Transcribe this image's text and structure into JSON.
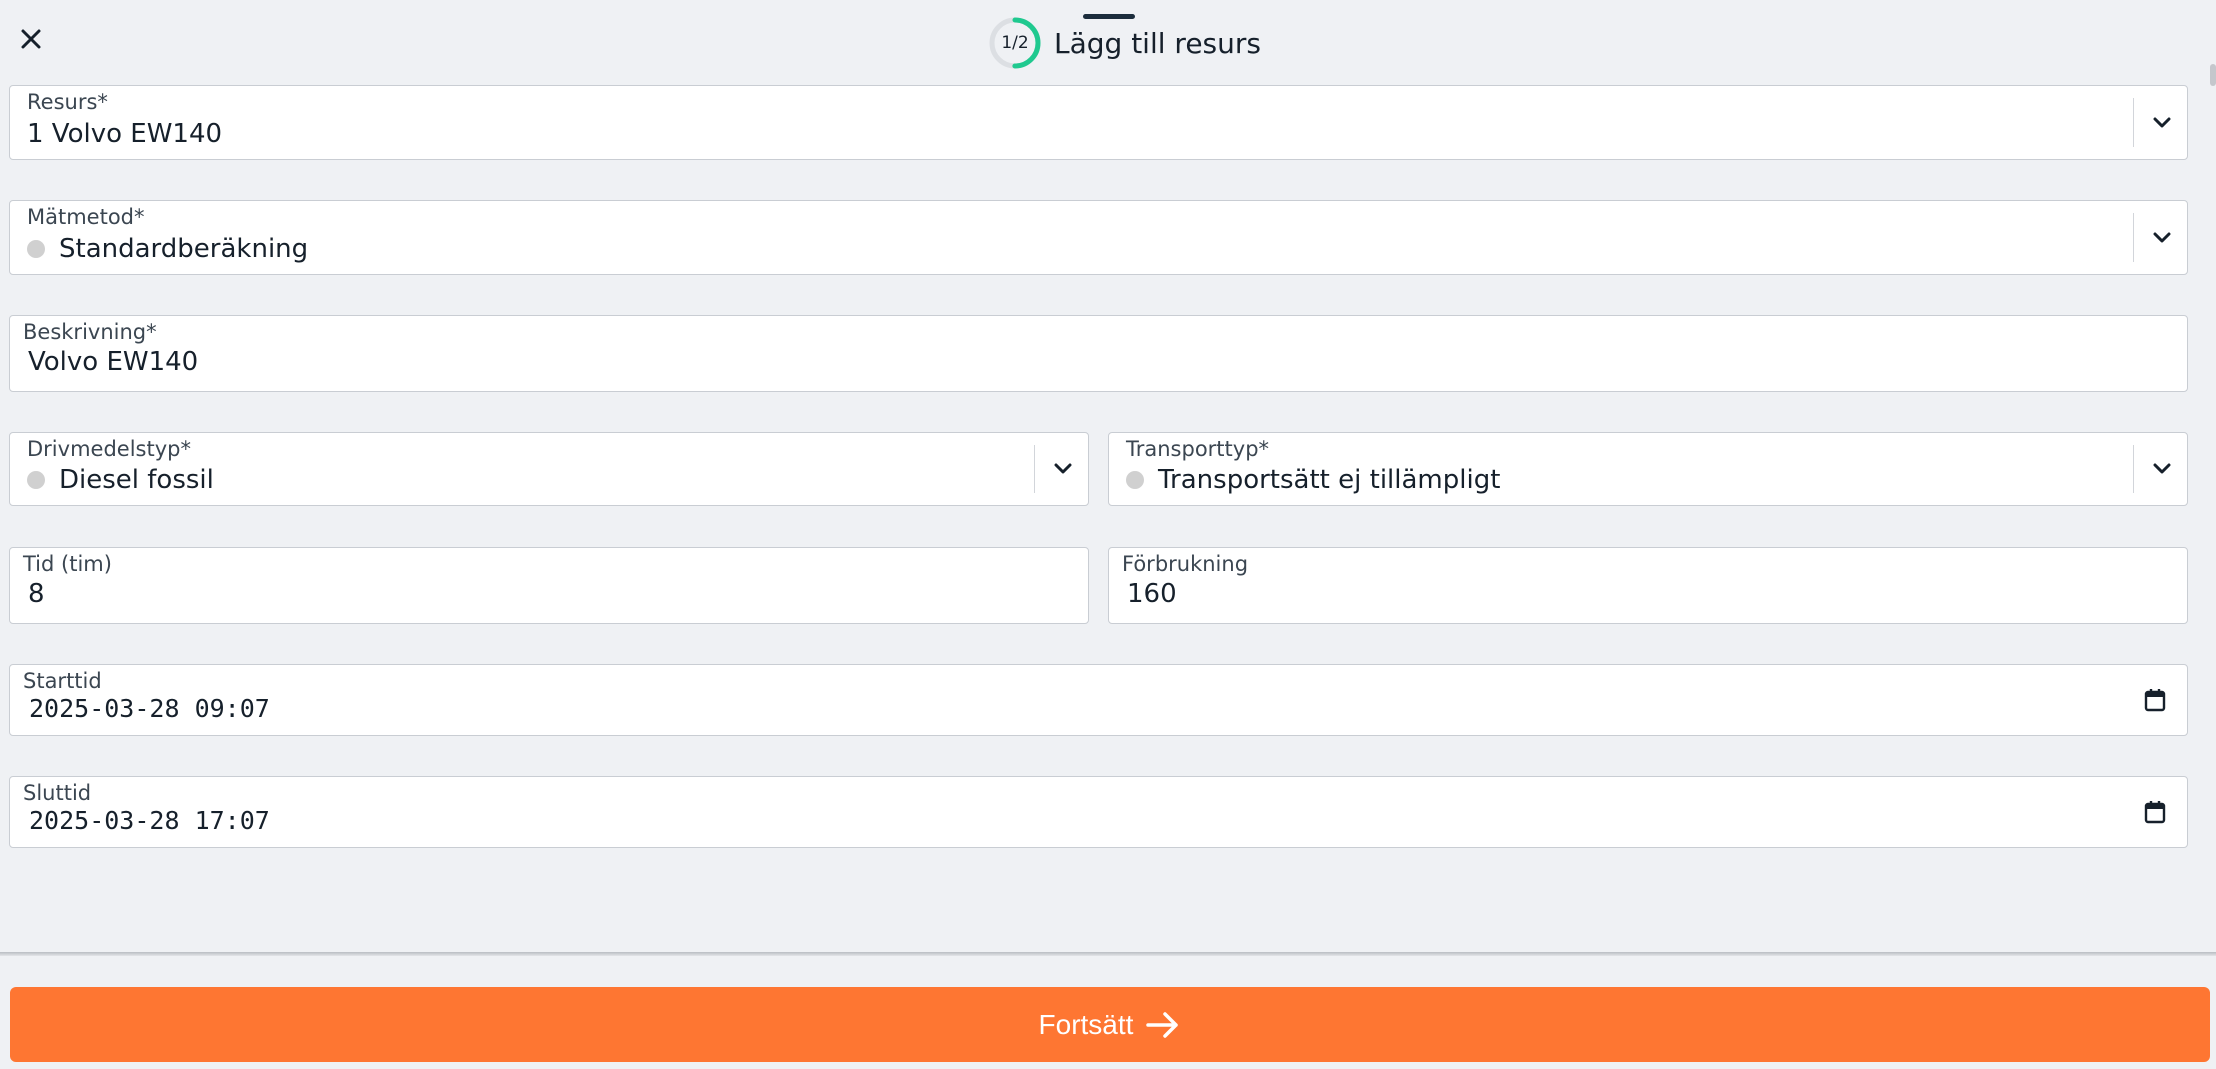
{
  "header": {
    "step": "1/2",
    "step_progress": 0.5,
    "title": "Lägg till resurs",
    "close_icon": "close-icon"
  },
  "form": {
    "resource": {
      "label": "Resurs*",
      "value": "1 Volvo EW140"
    },
    "method": {
      "label": "Mätmetod*",
      "value": "Standardberäkning"
    },
    "description": {
      "label": "Beskrivning*",
      "value": "Volvo EW140"
    },
    "fuel_type": {
      "label": "Drivmedelstyp*",
      "value": "Diesel fossil"
    },
    "transport_type": {
      "label": "Transporttyp*",
      "value": "Transportsätt ej tillämpligt"
    },
    "time": {
      "label": "Tid (tim)",
      "value": "8"
    },
    "consumption": {
      "label": "Förbrukning",
      "value": "160"
    },
    "start_time": {
      "label": "Starttid",
      "value": "2025-03-28 09:07"
    },
    "end_time": {
      "label": "Sluttid",
      "value": "2025-03-28 17:07"
    }
  },
  "footer": {
    "continue_label": "Fortsätt",
    "continue_icon": "arrow-right-icon"
  },
  "colors": {
    "accent": "#fe7632",
    "progress": "#1fc98f",
    "background": "#eff1f4",
    "text": "#16202b"
  }
}
